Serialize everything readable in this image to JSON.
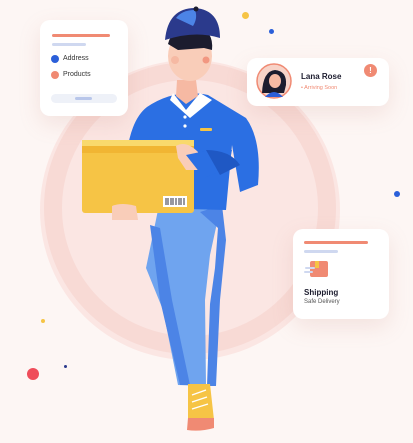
{
  "checklist_card": {
    "items": [
      {
        "label": "Address",
        "dot_color": "#2b5fd9"
      },
      {
        "label": "Products",
        "dot_color": "#f08a73"
      }
    ]
  },
  "contact_card": {
    "name": "Lana Rose",
    "status": "Arriving Soon",
    "status_dot": "•",
    "alert_icon": "!"
  },
  "shipping_card": {
    "title": "Shipping",
    "subtitle": "Safe Delivery"
  },
  "colors": {
    "accent": "#f08a73",
    "primary": "#2b5fd9",
    "background": "#fdf6f4"
  }
}
